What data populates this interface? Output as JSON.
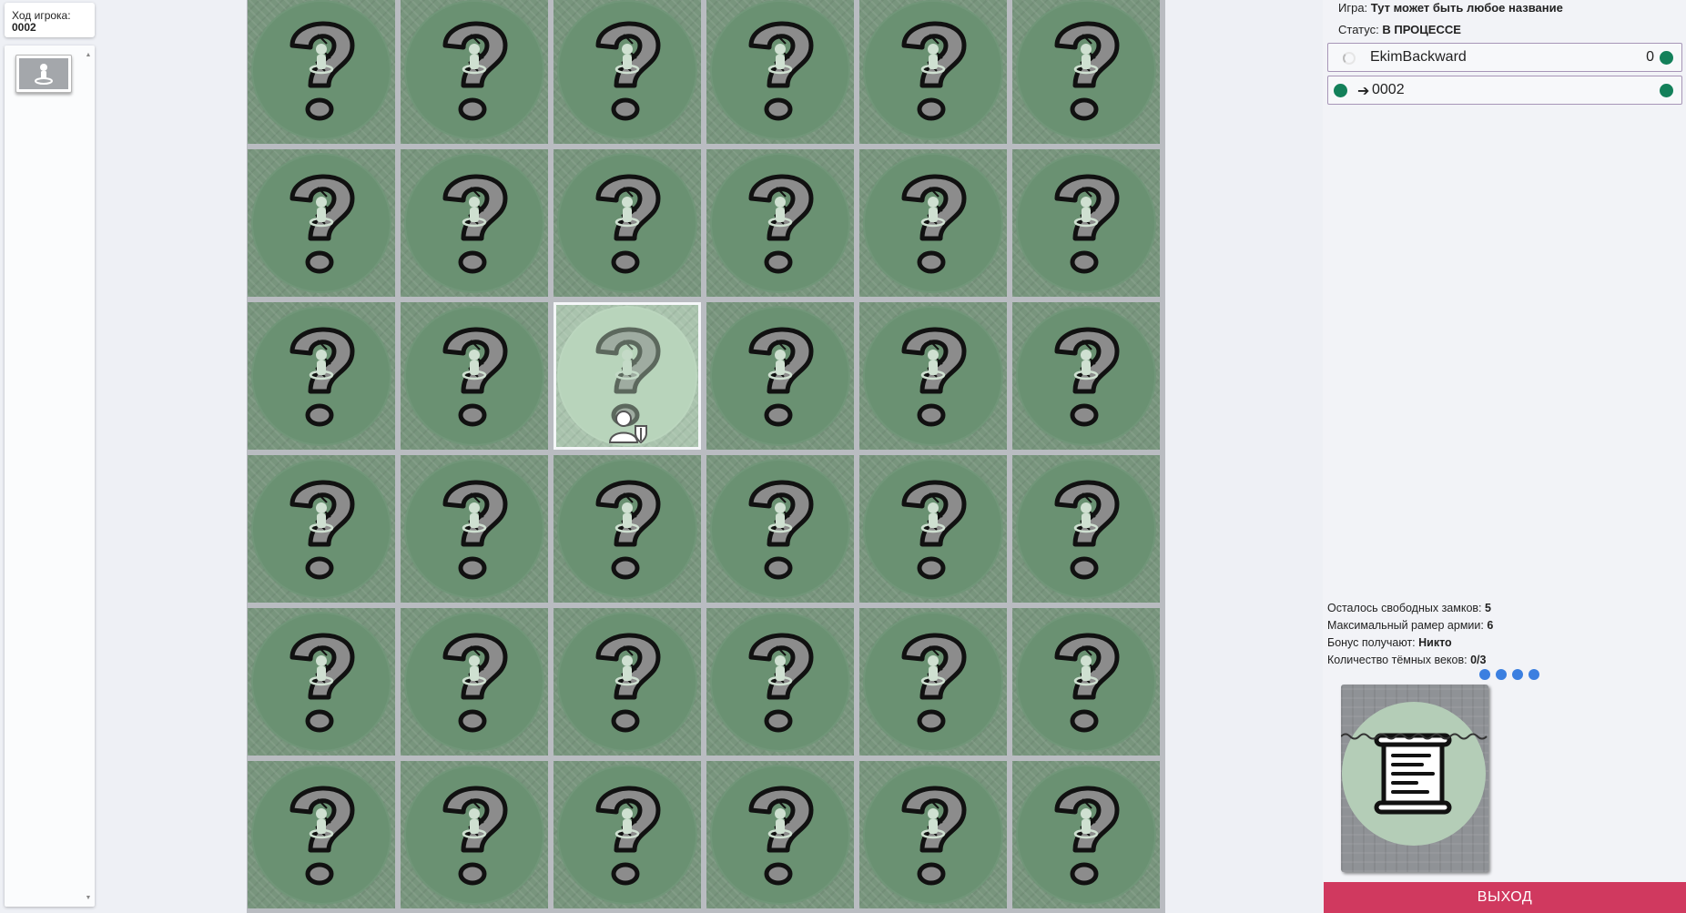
{
  "turn": {
    "label": "Ход игрока:",
    "player": "0002"
  },
  "hand": {
    "cards": [
      {
        "icon": "meeple-icon"
      }
    ]
  },
  "board": {
    "rows": 6,
    "cols": 6,
    "tile_icon": "question-mark-icon",
    "selected": {
      "row": 3,
      "col": 3,
      "icon": "unit-shield-icon"
    }
  },
  "game": {
    "name_label": "Игра:",
    "name": "Тут может быть любое название",
    "status_label": "Статус:",
    "status": "В ПРОЦЕССЕ"
  },
  "players": [
    {
      "name": "EkimBackward",
      "score": "0",
      "active": false,
      "indicator_color": "#13805a"
    },
    {
      "name": "0002",
      "score": "",
      "active": true,
      "indicator_color": "#13805a"
    }
  ],
  "stats": [
    {
      "label": "Осталось свободных замков: ",
      "value": "5"
    },
    {
      "label": "Максимальный рамер армии: ",
      "value": "6"
    },
    {
      "label": "Бонус получают: ",
      "value": "Никто"
    },
    {
      "label": "Количество тёмных веков: ",
      "value": "0/3"
    }
  ],
  "dark_age_dots": 4,
  "deck": {
    "icon": "scroll-icon"
  },
  "exit_label": "ВЫХОД",
  "colors": {
    "accent": "#d0395f",
    "player": "#13805a",
    "tile": "#6a9172",
    "dots": "#3b7fe0"
  }
}
